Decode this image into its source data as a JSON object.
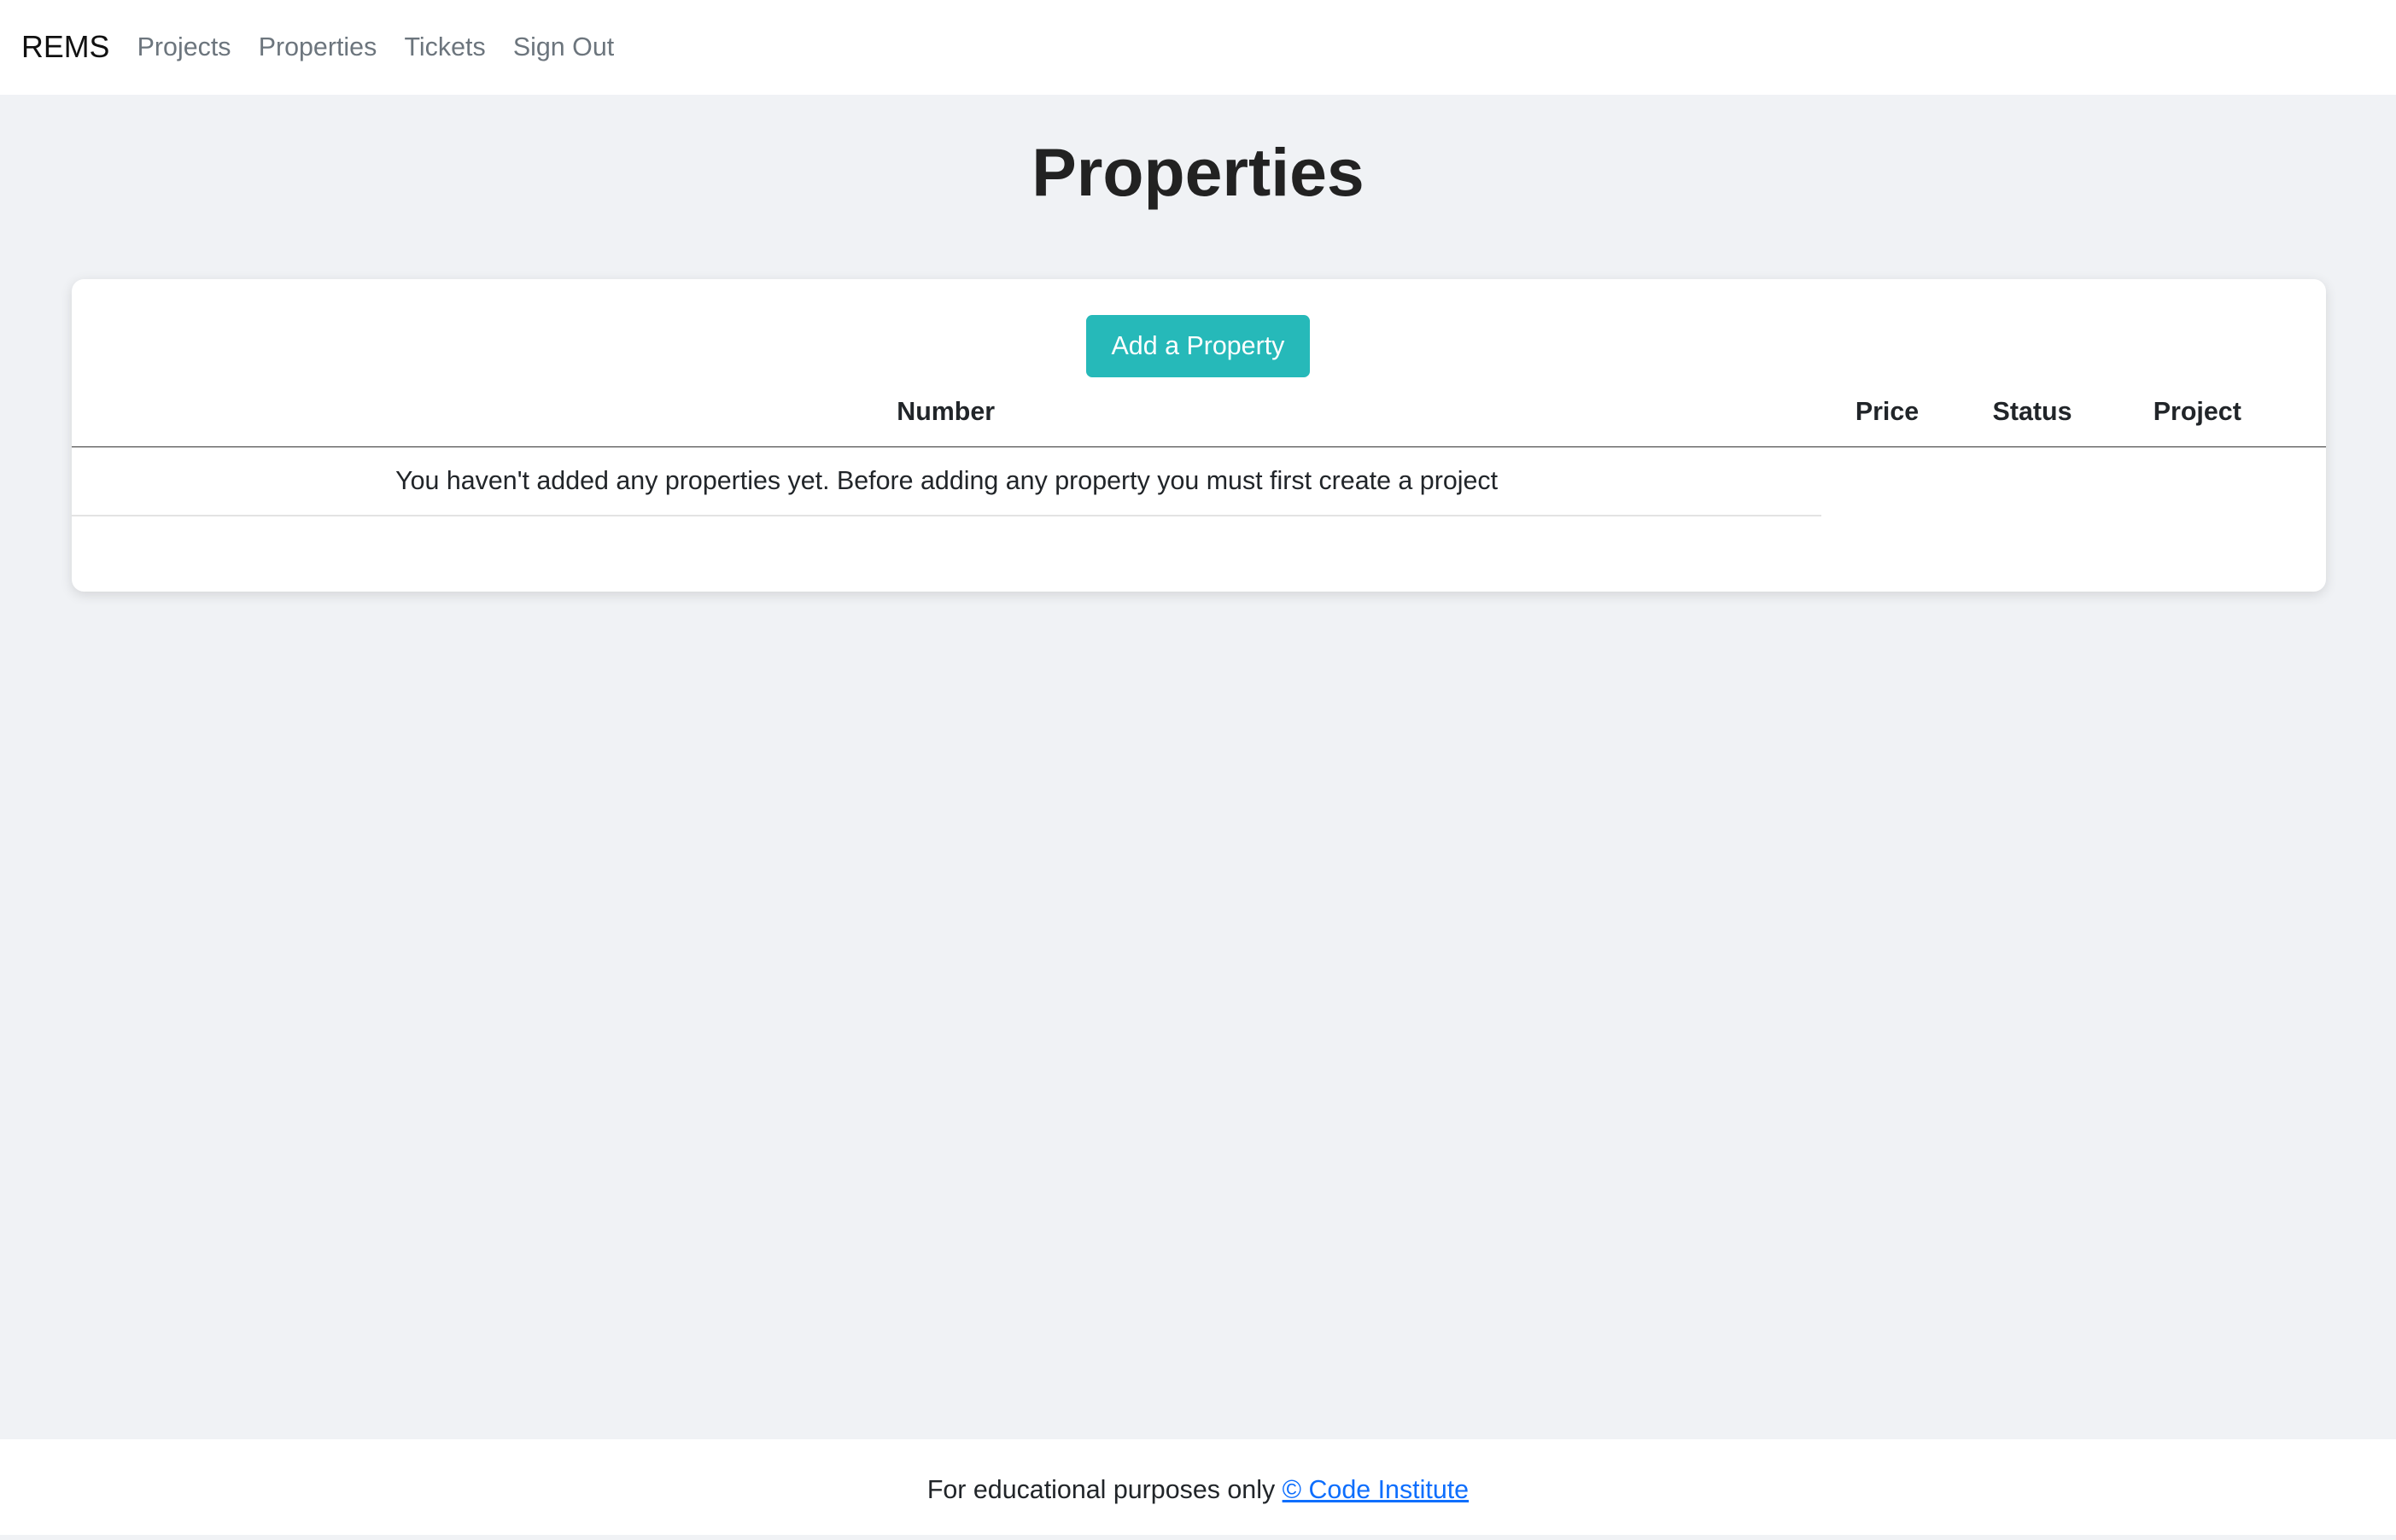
{
  "nav": {
    "brand": "REMS",
    "links": [
      "Projects",
      "Properties",
      "Tickets",
      "Sign Out"
    ]
  },
  "page": {
    "title": "Properties"
  },
  "card": {
    "add_button": "Add a Property",
    "columns": [
      "Number",
      "Price",
      "Status",
      "Project"
    ],
    "empty_message": "You haven't added any properties yet. Before adding any property you must first create a project"
  },
  "footer": {
    "text": "For educational purposes only",
    "link": "© Code Institute"
  },
  "colors": {
    "accent": "#26b9b9",
    "link": "#0d6efd"
  }
}
